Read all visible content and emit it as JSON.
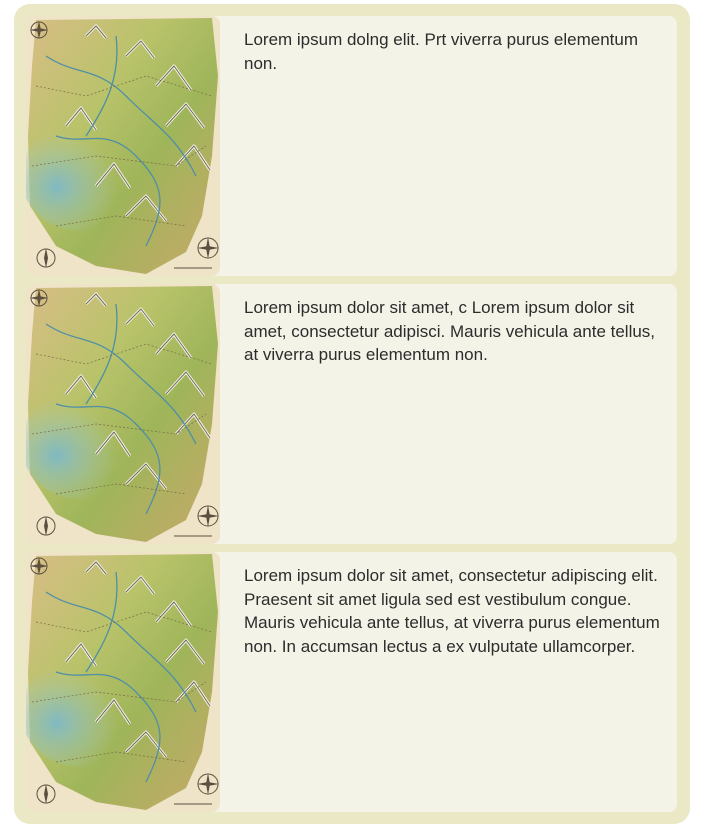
{
  "cards": [
    {
      "image": "fantasy-terrain-map",
      "text": "Lorem ipsum dolng elit. Prt viverra purus elementum non."
    },
    {
      "image": "fantasy-terrain-map",
      "text": "Lorem ipsum dolor sit amet, c Lorem ipsum dolor sit amet, consectetur adipisci. Mauris vehicula ante tellus, at viverra purus elementum non."
    },
    {
      "image": "fantasy-terrain-map",
      "text": "Lorem ipsum dolor sit amet, consectetur adipiscing elit. Praesent sit amet ligula sed est vestibulum congue. Mauris vehicula ante tellus, at viverra purus elementum non. In accumsan lectus a ex vulputate ullamcorper."
    }
  ],
  "colors": {
    "frame": "#ebe8c5",
    "card": "#f4f3e8",
    "text": "#2c2c2c"
  }
}
